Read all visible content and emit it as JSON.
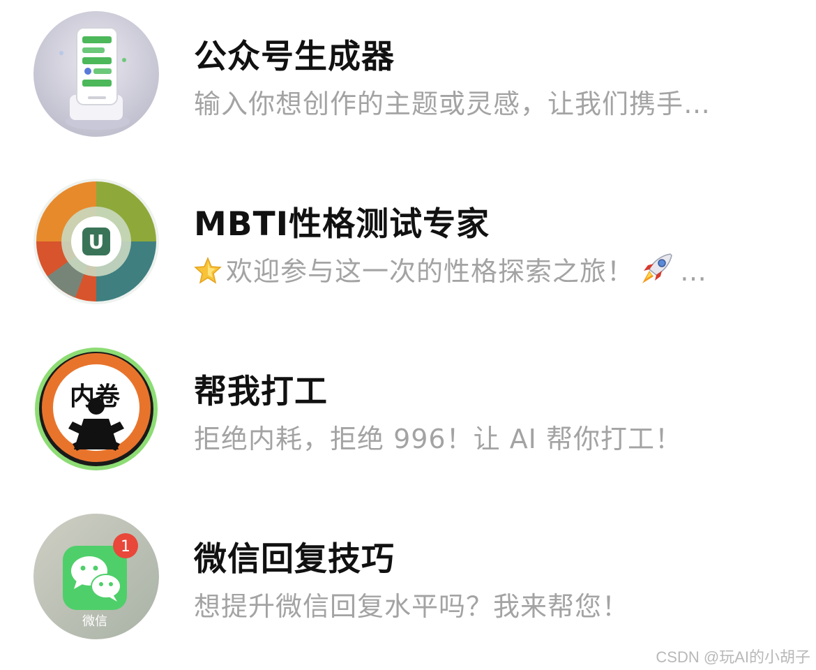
{
  "items": [
    {
      "icon": "phone-app-icon",
      "title": "公众号生成器",
      "subtitle": "输入你想创作的主题或灵感，让我们携手…"
    },
    {
      "icon": "mbti-chart-icon",
      "title": "MBTI性格测试专家",
      "subtitle_before": "欢迎参与这一次的性格探索之旅！",
      "subtitle_after": "…",
      "emoji_start": "star-emoji",
      "emoji_end": "rocket-emoji"
    },
    {
      "icon": "no-involution-sign-icon",
      "title": "帮我打工",
      "subtitle": "拒绝内耗，拒绝 996！让 AI 帮你打工！",
      "sign_text": "内卷"
    },
    {
      "icon": "wechat-app-icon",
      "title": "微信回复技巧",
      "subtitle": "想提升微信回复水平吗？我来帮您！",
      "badge": "1",
      "app_label": "微信"
    }
  ],
  "watermark": "CSDN @玩AI的小胡子"
}
